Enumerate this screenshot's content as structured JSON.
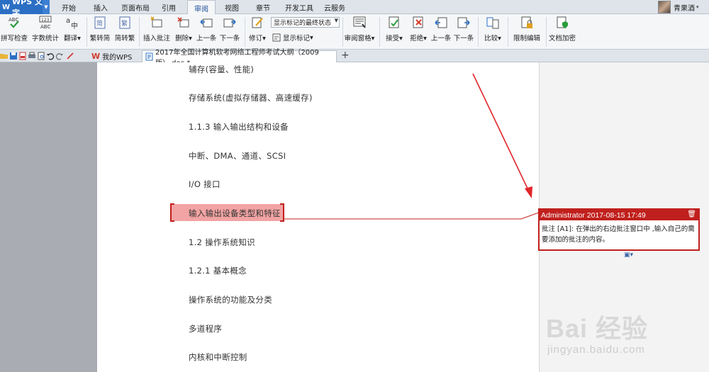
{
  "app": {
    "name": "WPS 文字"
  },
  "menu_tabs": [
    "开始",
    "插入",
    "页面布局",
    "引用",
    "审阅",
    "视图",
    "章节",
    "开发工具",
    "云服务"
  ],
  "active_tab": "审阅",
  "user": {
    "name": "青果酒"
  },
  "ribbon": {
    "spell_check": "拼写检查",
    "word_count": "字数统计",
    "translate": "翻译",
    "trad_to_simp": "繁转简",
    "simp_to_trad": "简转繁",
    "insert_comment": "插入批注",
    "delete": "删除",
    "prev1": "上一条",
    "next1": "下一条",
    "revise": "修订",
    "display_select": "显示标记的最终状态",
    "show_markup": "显示标记",
    "review_pane": "审阅窗格",
    "accept": "接受",
    "reject": "拒绝",
    "prev2": "上一条",
    "next2": "下一条",
    "compare": "比较",
    "restrict_edit": "限制编辑",
    "encrypt": "文档加密",
    "abc_small": "ABC",
    "count_small": "123"
  },
  "doc_tabs": {
    "mywps": "我的WPS",
    "doc": "2017年全国计算机软考网络工程师考试大纲（2009版）.doc *"
  },
  "document": {
    "paragraphs": [
      "辅存(容量、性能)",
      "存储系统(虚拟存储器、高速缓存)",
      "1.1.3 输入输出结构和设备",
      "中断、DMA、通道、SCSI",
      "I/O 接口",
      "输入输出设备类型和特征",
      "1.2 操作系统知识",
      "1.2.1 基本概念",
      "操作系统的功能及分类",
      "多道程序",
      "内核和中断控制"
    ]
  },
  "comment": {
    "header": "Administrator 2017-08-15 17:49",
    "body": "批注 [A1]: 在弹出的右边批注窗口中 ,输入自己的需要添加的批注的内容。"
  },
  "watermark": {
    "main": "Bai 经验",
    "url": "jingyan.baidu.com"
  },
  "colors": {
    "accent": "#c0201d",
    "highlight": "#f2a3a3",
    "app_blue": "#2b6fc4"
  }
}
